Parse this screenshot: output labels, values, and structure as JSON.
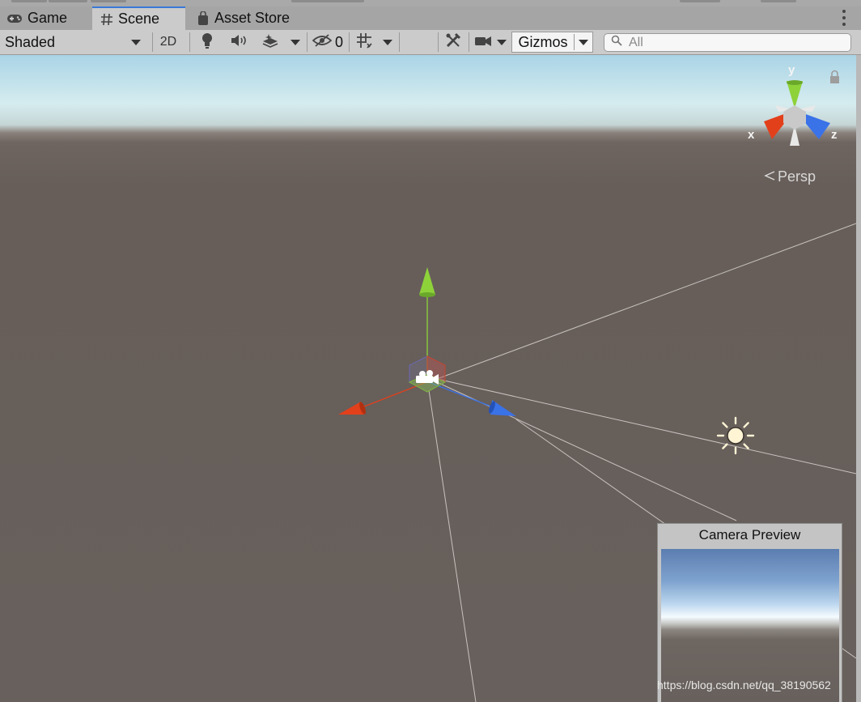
{
  "tabs": [
    {
      "label": "Game",
      "icon": "gamepad-icon",
      "active": false
    },
    {
      "label": "Scene",
      "icon": "hash-icon",
      "active": true
    },
    {
      "label": "Asset Store",
      "icon": "shopping-bag-icon",
      "active": false
    }
  ],
  "toolbar": {
    "draw_mode": "Shaded",
    "toggle_2d": "2D",
    "hidden_count": "0",
    "gizmos_label": "Gizmos",
    "icons": [
      "lightbulb-icon",
      "speaker-icon",
      "effects-layers-icon",
      "visibility-eye-icon",
      "grid-icon",
      "tools-icon",
      "camera-icon"
    ]
  },
  "search": {
    "placeholder": "All",
    "value": ""
  },
  "scene": {
    "projection_label": "Persp",
    "axes": {
      "x": "x",
      "y": "y",
      "z": "z"
    },
    "colors": {
      "x_axis": "#e2401b",
      "y_axis": "#8ed23a",
      "z_axis": "#3a72e8",
      "sky": "#d5ecef",
      "ground": "#67605c"
    }
  },
  "camera_preview": {
    "title": "Camera Preview"
  },
  "watermark": "https://blog.csdn.net/qq_38190562"
}
